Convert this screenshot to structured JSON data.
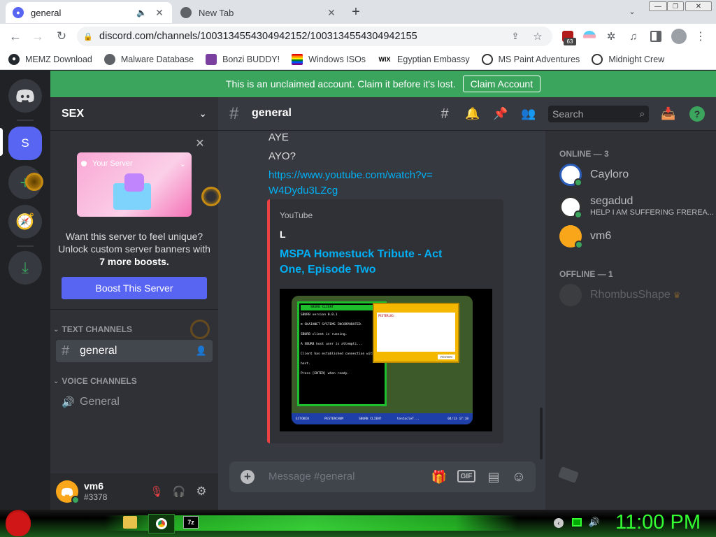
{
  "browser": {
    "tabs": [
      {
        "title": "general",
        "active": true
      },
      {
        "title": "New Tab",
        "active": false
      }
    ],
    "url": "discord.com/channels/1003134554304942152/1003134554304942155",
    "extension_badge": "63",
    "bookmarks": [
      "MEMZ Download",
      "Malware Database",
      "Bonzi BUDDY!",
      "Windows ISOs",
      "Egyptian Embassy",
      "MS Paint Adventures",
      "Midnight Crew"
    ]
  },
  "discord": {
    "banner_text": "This is an unclaimed account. Claim it before it's lost.",
    "banner_button": "Claim Account",
    "server_initial": "S",
    "server_name": "SEX",
    "boost_card": {
      "image_label": "Your Server",
      "text_line1": "Want this server to feel unique?",
      "text_line2": "Unlock custom server banners with",
      "text_line3": "7 more boosts.",
      "button": "Boost This Server"
    },
    "text_channels_label": "TEXT CHANNELS",
    "text_channels": [
      "general"
    ],
    "voice_channels_label": "VOICE CHANNELS",
    "voice_channels": [
      "General"
    ],
    "user": {
      "name": "vm6",
      "tag": "#3378"
    },
    "channel_title": "general",
    "search_placeholder": "Search",
    "messages": [
      "AYE",
      "AYO?"
    ],
    "link": "https://www.youtube.com/watch?v=W4Dydu3LZcg",
    "embed": {
      "provider": "YouTube",
      "author": "L",
      "title": "MSPA Homestuck Tribute - Act One, Episode Two",
      "video": {
        "window_title": "SBURB CLIENT",
        "lines": [
          "SBURB version 0.0.1",
          "© SKAIANET SYSTEMS INCORPORATED.",
          "SBURB client is running.",
          "A SBURB host user is attempti...",
          "Client has established connection with host.",
          "Press [ENTER] when ready."
        ],
        "pester_title": "PESTERLOG:",
        "pester_button": "PESTER!",
        "task_items": [
          "ECTOBIO",
          "PESTERCHUM",
          "SBURB CLIENT",
          "tentacleT..."
        ],
        "clock": "04/13 17:18"
      }
    },
    "composer_placeholder": "Message #general",
    "members": {
      "online_header": "ONLINE — 3",
      "online": [
        {
          "name": "Cayloro",
          "status": ""
        },
        {
          "name": "segadud",
          "status": "HELP I AM SUFFERING FREREA..."
        },
        {
          "name": "vm6",
          "status": ""
        }
      ],
      "offline_header": "OFFLINE — 1",
      "offline": [
        {
          "name": "RhombusShape",
          "status": ""
        }
      ]
    }
  },
  "taskbar": {
    "clock": "11:00 PM",
    "tray_app": "7z"
  },
  "colors": {
    "blurple": "#5865f2",
    "green": "#3ba55d",
    "link": "#00aff4",
    "red": "#ed4245"
  }
}
